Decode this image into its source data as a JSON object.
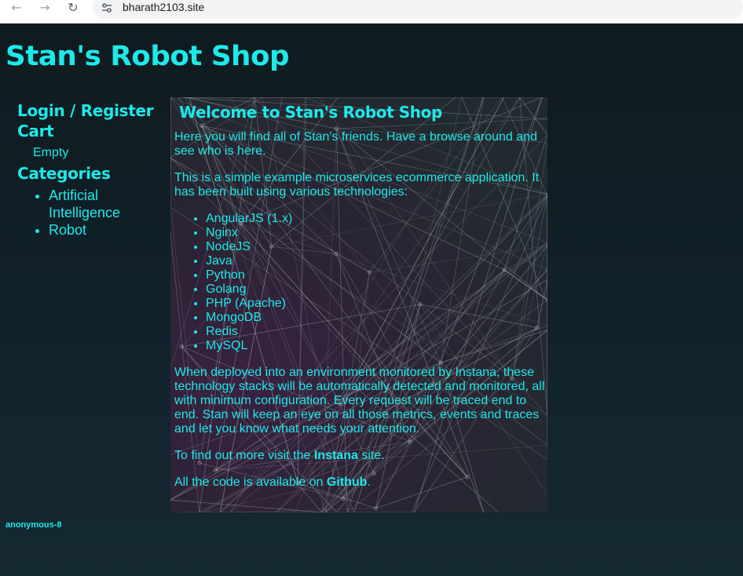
{
  "browser": {
    "url": "bharath2103.site",
    "back_icon": "arrow-left-icon",
    "forward_icon": "arrow-right-icon",
    "reload_icon": "reload-icon",
    "site_info_icon": "tune-icon"
  },
  "header": {
    "title": "Stan's Robot Shop"
  },
  "sidebar": {
    "login_label": "Login / Register",
    "cart_heading": "Cart",
    "cart_status": "Empty",
    "categories_heading": "Categories",
    "categories": [
      {
        "label": "Artificial Intelligence"
      },
      {
        "label": "Robot"
      }
    ]
  },
  "main": {
    "title": "Welcome to Stan's Robot Shop",
    "intro": "Here you will find all of Stan's friends. Have a browse around and see who is here.",
    "description": "This is a simple example microservices ecommerce application. It has been built using various technologies:",
    "technologies": [
      "AngularJS (1.x)",
      "Nginx",
      "NodeJS",
      "Java",
      "Python",
      "Golang",
      "PHP (Apache)",
      "MongoDB",
      "Redis",
      "MySQL"
    ],
    "monitoring": "When deployed into an environment monitored by Instana, these technology stacks will be automatically detected and monitored, all with minimum configuration. Every request will be traced end to end. Stan will keep an eye on all those metrics, events and traces and let you know what needs your attention.",
    "instana_prefix": "To find out more visit the ",
    "instana_link": "Instana",
    "instana_suffix": " site.",
    "github_prefix": "All the code is available on ",
    "github_link": "Github",
    "github_suffix": "."
  },
  "footer": {
    "user": "anonymous-8"
  },
  "colors": {
    "accent": "#1de9e9",
    "background": "#11212a",
    "panel": "#24282f"
  }
}
